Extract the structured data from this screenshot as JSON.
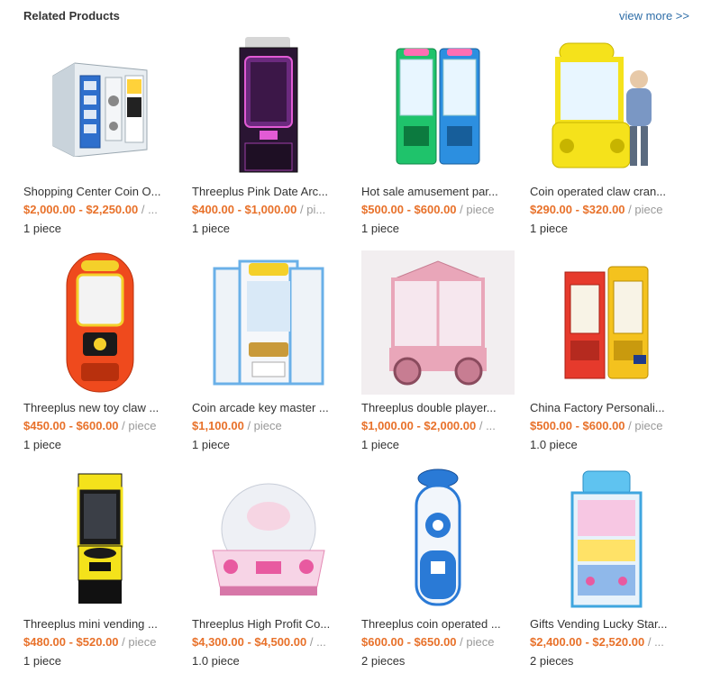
{
  "section": {
    "title": "Related Products",
    "view_more": "view more >>"
  },
  "products": [
    {
      "name": "Shopping Center Coin O...",
      "price": "$2,000.00 - $2,250.00",
      "unit": " / ...",
      "moq": "1 piece",
      "icon": "vending-cabinet-icon"
    },
    {
      "name": "Threeplus Pink Date Arc...",
      "price": "$400.00 - $1,000.00",
      "unit": " / pi...",
      "moq": "1 piece",
      "icon": "pink-claw-machine-icon"
    },
    {
      "name": "Hot sale amusement par...",
      "price": "$500.00 - $600.00",
      "unit": " / piece",
      "moq": "1 piece",
      "icon": "double-claw-machine-icon"
    },
    {
      "name": "Coin operated claw cran...",
      "price": "$290.00 - $320.00",
      "unit": " / piece",
      "moq": "1 piece",
      "icon": "yellow-claw-crane-icon"
    },
    {
      "name": "Threeplus new toy claw ...",
      "price": "$450.00 - $600.00",
      "unit": " / piece",
      "moq": "1 piece",
      "icon": "red-capsule-claw-icon"
    },
    {
      "name": "Coin arcade key master ...",
      "price": "$1,100.00",
      "unit": " / piece",
      "moq": "1 piece",
      "icon": "key-master-arcade-icon"
    },
    {
      "name": "Threeplus double player...",
      "price": "$1,000.00 - $2,000.00",
      "unit": " / ...",
      "moq": "1 piece",
      "icon": "pink-cart-claw-icon"
    },
    {
      "name": "China Factory Personali...",
      "price": "$500.00 - $600.00",
      "unit": " / piece",
      "moq": "1.0 piece",
      "icon": "phone-booth-claw-icon"
    },
    {
      "name": "Threeplus mini vending ...",
      "price": "$480.00 - $520.00",
      "unit": " / piece",
      "moq": "1 piece",
      "icon": "mini-vending-machine-icon"
    },
    {
      "name": "Threeplus High Profit Co...",
      "price": "$4,300.00 - $4,500.00",
      "unit": " / ...",
      "moq": "1.0 piece",
      "icon": "dome-claw-machine-icon"
    },
    {
      "name": "Threeplus coin operated ...",
      "price": "$600.00 - $650.00",
      "unit": " / piece",
      "moq": "2 pieces",
      "icon": "capsule-toy-machine-icon"
    },
    {
      "name": "Gifts Vending Lucky Star...",
      "price": "$2,400.00 - $2,520.00",
      "unit": " / ...",
      "moq": "2 pieces",
      "icon": "lucky-star-arcade-icon"
    }
  ],
  "colors": {
    "price": "#e8712a",
    "link": "#2f6ea8",
    "text": "#333333",
    "muted": "#999999"
  }
}
